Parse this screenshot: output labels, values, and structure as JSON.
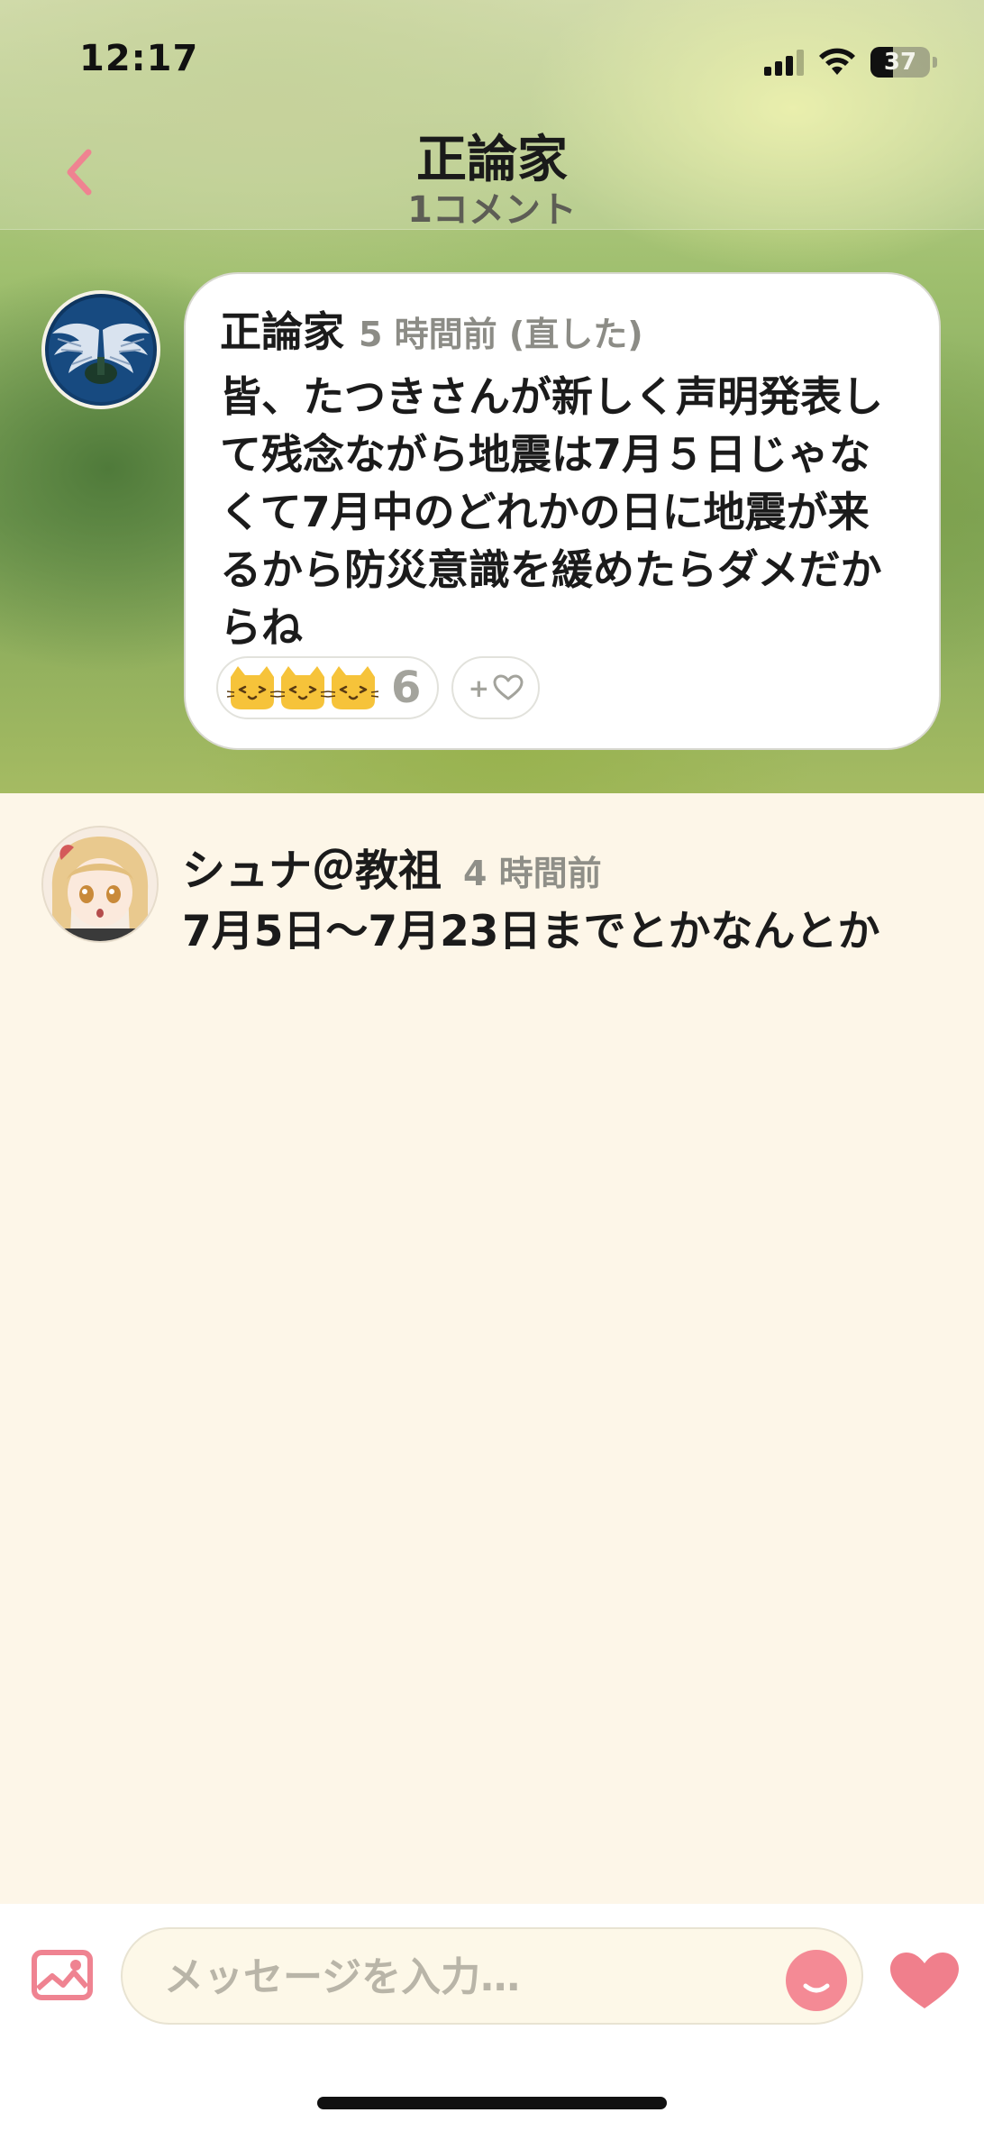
{
  "status_bar": {
    "time": "12:17",
    "battery": "37"
  },
  "nav": {
    "title": "正論家",
    "subtitle": "1コメント"
  },
  "post": {
    "author": "正論家",
    "meta": "5 時間前 (直した)",
    "body": "皆、たつきさんが新しく声明発表して残念ながら地震は7月５日じゃなくて7月中のどれかの日に地震が来るから防災意識を緩めたらダメだからね",
    "reaction_count": "6",
    "add_reaction_label": "+"
  },
  "comment": {
    "author": "シュナ＠教祖",
    "time": "4 時間前",
    "body": "7月5日〜7月23日までとかなんとか"
  },
  "composer": {
    "placeholder": "メッセージを入力…"
  },
  "colors": {
    "accent": "#f07f8c",
    "cream": "#fdf6e8"
  }
}
